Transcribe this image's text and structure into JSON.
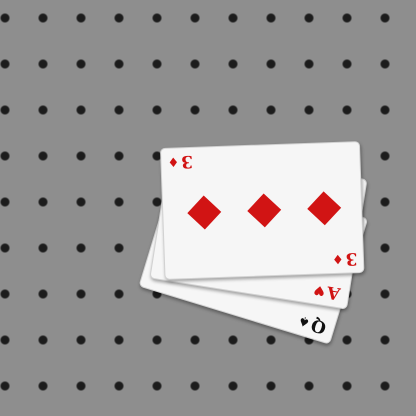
{
  "scene": {
    "background": "pegboard",
    "colors": {
      "board": "#8e8e8e",
      "hole": "#1c1c1c",
      "card_face": "#f6f6f6",
      "red_suit": "#d11414",
      "black_suit": "#111111"
    }
  },
  "cards": {
    "bottom": {
      "rank": "Q",
      "suit": "spades",
      "suit_symbol": "♠",
      "color": "black"
    },
    "middle": {
      "rank": "A",
      "suit": "hearts",
      "suit_symbol": "♥",
      "color": "red"
    },
    "top": {
      "rank": "3",
      "suit": "diamonds",
      "suit_symbol": "♦",
      "color": "red",
      "pip_count": 3
    }
  }
}
